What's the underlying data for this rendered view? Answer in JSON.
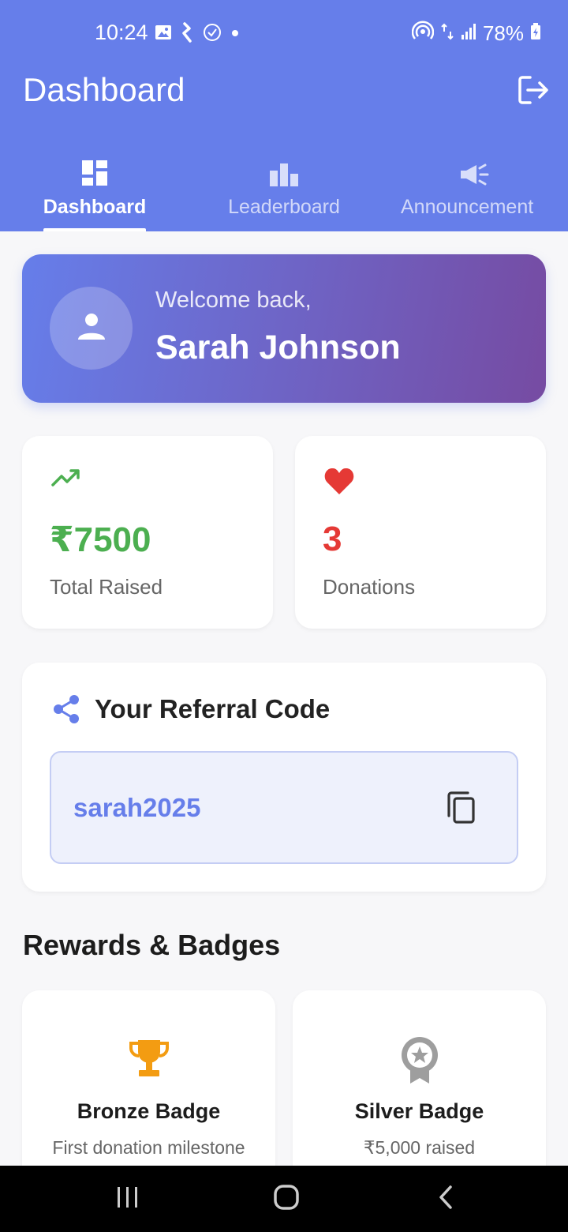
{
  "status_bar": {
    "time": "10:24",
    "battery": "78%",
    "icons_left": [
      "gallery-icon",
      "k-app-icon",
      "check-circle-icon",
      "dot-icon"
    ],
    "icons_right": [
      "hotspot-icon",
      "data-arrows-icon",
      "signal-icon",
      "battery-charging-icon"
    ]
  },
  "header": {
    "title": "Dashboard",
    "logout_icon": "logout-icon"
  },
  "tabs": [
    {
      "label": "Dashboard",
      "icon": "dashboard-icon",
      "active": true
    },
    {
      "label": "Leaderboard",
      "icon": "leaderboard-icon",
      "active": false
    },
    {
      "label": "Announcement",
      "icon": "campaign-icon",
      "active": false
    }
  ],
  "welcome": {
    "greeting": "Welcome back,",
    "name": "Sarah Johnson"
  },
  "stats": {
    "total_raised": {
      "value": "₹7500",
      "label": "Total Raised",
      "icon": "trending-up-icon",
      "color": "#4caf50"
    },
    "donations": {
      "value": "3",
      "label": "Donations",
      "icon": "heart-icon",
      "color": "#e53935"
    }
  },
  "referral": {
    "title": "Your Referral Code",
    "code": "sarah2025",
    "icon": "share-icon",
    "copy_icon": "copy-icon"
  },
  "rewards": {
    "title": "Rewards & Badges",
    "badges": [
      {
        "title": "Bronze Badge",
        "description": "First donation milestone",
        "icon": "trophy-icon",
        "color": "#f39c12"
      },
      {
        "title": "Silver Badge",
        "description": "₹5,000 raised",
        "icon": "award-ribbon-icon",
        "color": "#9e9e9e"
      }
    ]
  },
  "colors": {
    "primary": "#667eea",
    "gradient_end": "#764ba2",
    "success": "#4caf50",
    "danger": "#e53935"
  },
  "nav_bar": [
    "recent-apps-icon",
    "home-icon",
    "back-icon"
  ]
}
